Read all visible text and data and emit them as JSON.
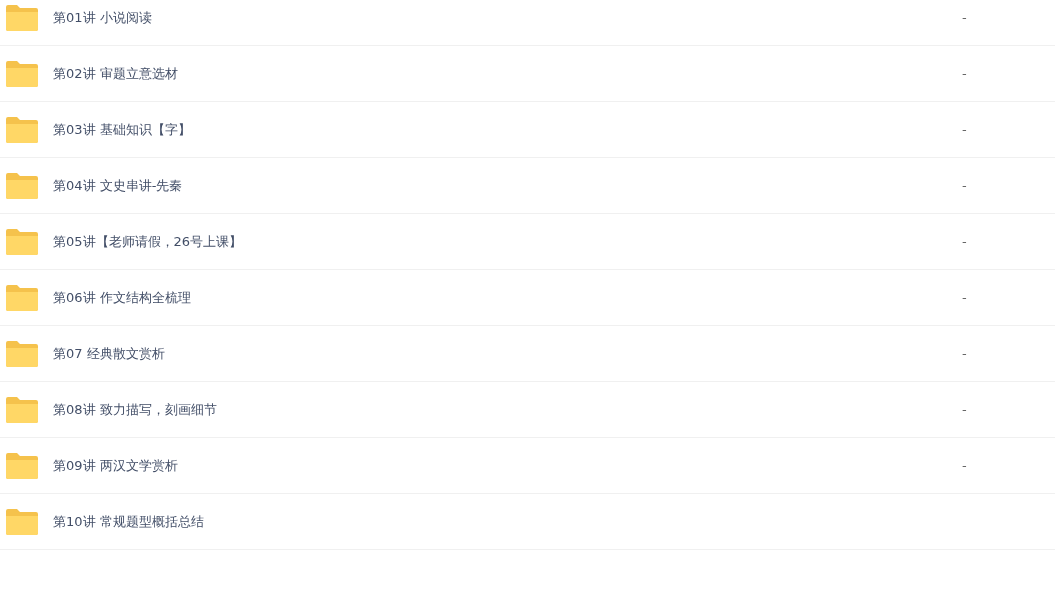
{
  "rows": [
    {
      "name": "第01讲 小说阅读",
      "size": "-"
    },
    {
      "name": "第02讲 审题立意选材",
      "size": "-"
    },
    {
      "name": "第03讲 基础知识【字】",
      "size": "-"
    },
    {
      "name": "第04讲 文史串讲-先秦",
      "size": "-"
    },
    {
      "name": "第05讲【老师请假，26号上课】",
      "size": "-"
    },
    {
      "name": "第06讲 作文结构全梳理",
      "size": "-"
    },
    {
      "name": "第07 经典散文赏析",
      "size": "-"
    },
    {
      "name": "第08讲 致力描写，刻画细节",
      "size": "-"
    },
    {
      "name": "第09讲 两汉文学赏析",
      "size": "-"
    },
    {
      "name": "第10讲 常规题型概括总结"
    }
  ]
}
